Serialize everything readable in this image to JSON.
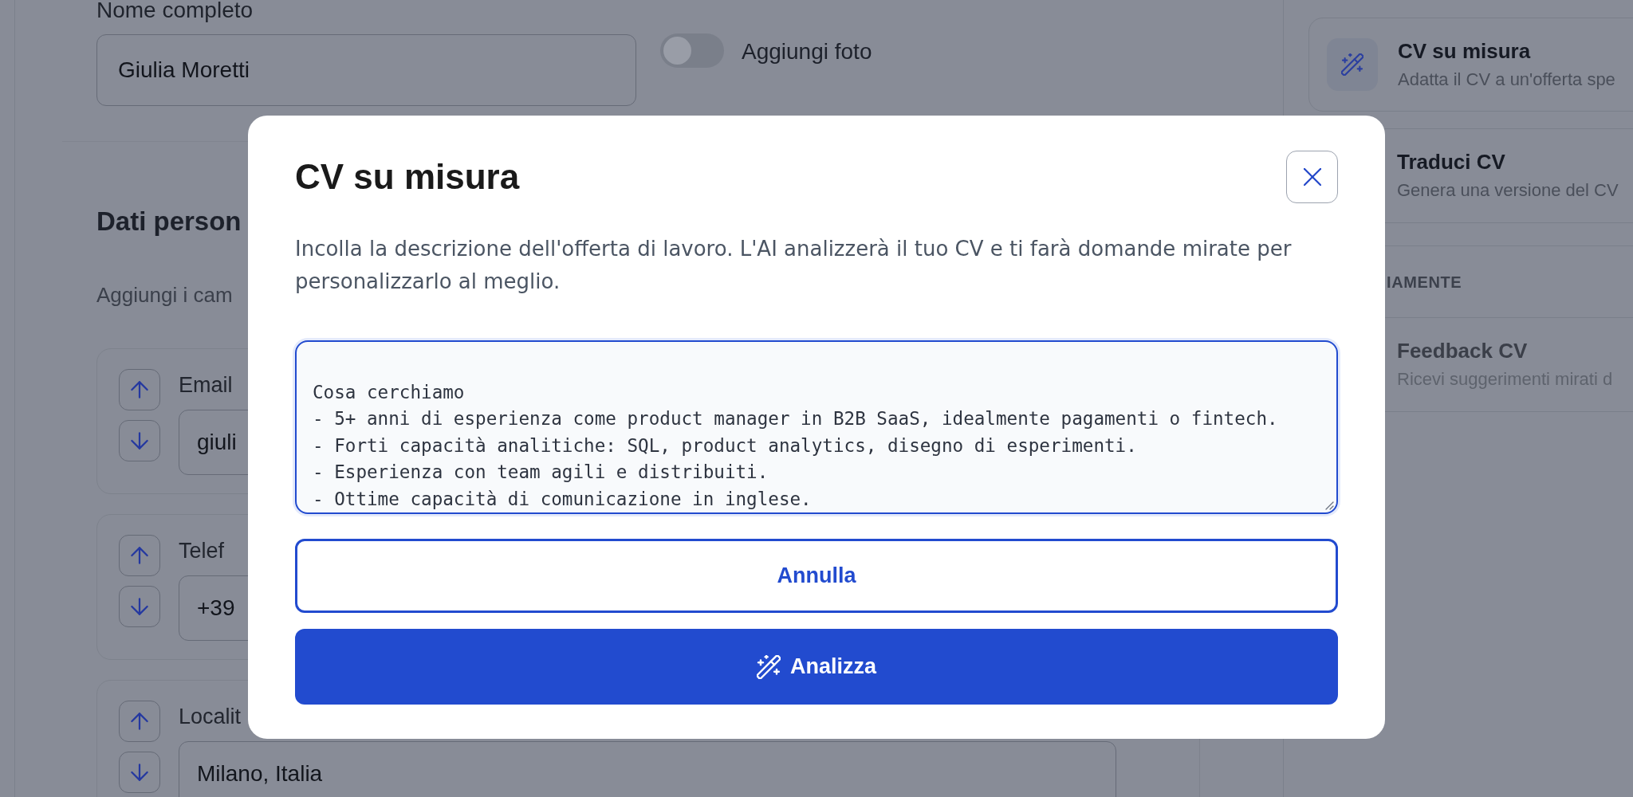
{
  "main": {
    "name_field": {
      "label": "Nome completo",
      "value": "Giulia Moretti"
    },
    "photo_toggle": {
      "label": "Aggiungi foto",
      "on": false
    },
    "section": {
      "title": "Dati person",
      "subtitle": "Aggiungi i cam"
    },
    "contact_fields": [
      {
        "label": "Email",
        "value": "giuli"
      },
      {
        "label": "Telef",
        "value": "+39"
      },
      {
        "label": "Localit",
        "value": "Milano, Italia"
      }
    ]
  },
  "sidebar": {
    "groups": [
      {
        "items": [
          {
            "title": "CV su misura",
            "description": "Adatta il CV a un'offerta spe",
            "selected": true,
            "disabled": false
          },
          {
            "title": "Traduci CV",
            "description": "Genera una versione del CV",
            "selected": false,
            "disabled": false
          }
        ]
      },
      {
        "heading": "IAMENTE",
        "items": [
          {
            "title": "Feedback CV",
            "description": "Ricevi suggerimenti mirati d",
            "selected": false,
            "disabled": true
          }
        ]
      }
    ]
  },
  "modal": {
    "title": "CV su misura",
    "description": "Incolla la descrizione dell'offerta di lavoro. L'AI analizzerà il tuo CV e ti farà domande mirate per personalizzarlo al meglio.",
    "job_description": {
      "value": "Cosa cerchiamo\n- 5+ anni di esperienza come product manager in B2B SaaS, idealmente pagamenti o fintech.\n- Forti capacità analitiche: SQL, product analytics, disegno di esperimenti.\n- Esperienza con team agili e distribuiti.\n- Ottime capacità di comunicazione in inglese.",
      "focused": true
    },
    "buttons": [
      {
        "label": "Annulla",
        "kind": "secondary"
      },
      {
        "label": "Analizza",
        "kind": "primary"
      }
    ]
  }
}
